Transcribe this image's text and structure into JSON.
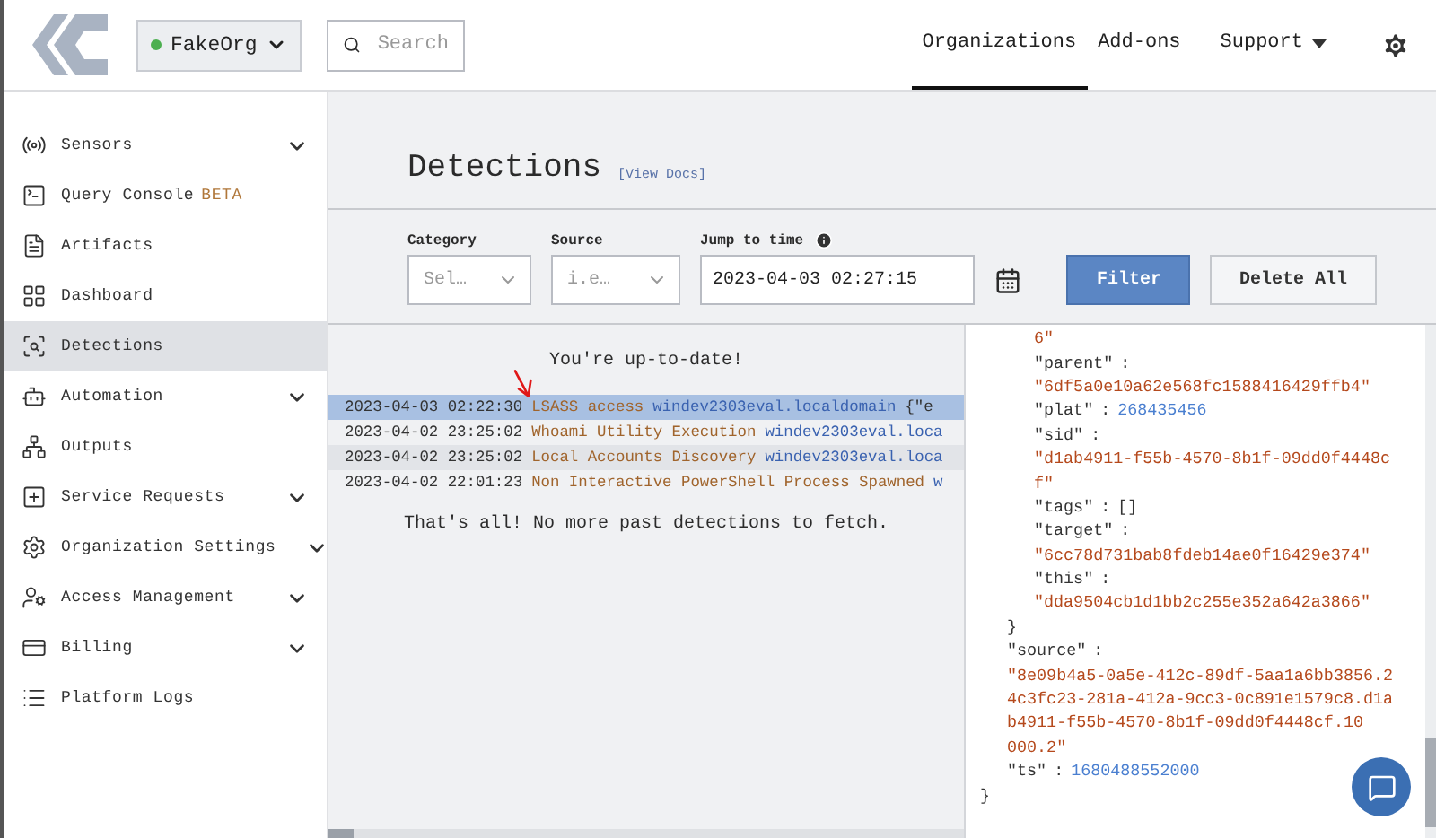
{
  "header": {
    "org": {
      "name": "FakeOrg"
    },
    "search": {
      "placeholder": "Search"
    },
    "nav": [
      {
        "label": "Organizations",
        "selected": true,
        "dropdown": false
      },
      {
        "label": "Add-ons",
        "selected": false,
        "dropdown": false
      },
      {
        "label": "Support",
        "selected": false,
        "dropdown": true
      }
    ]
  },
  "sidebar": {
    "items": [
      {
        "label": "Sensors",
        "expandable": true,
        "selected": false
      },
      {
        "label": "Query Console",
        "badge": "BETA",
        "expandable": false,
        "selected": false
      },
      {
        "label": "Artifacts",
        "expandable": false,
        "selected": false
      },
      {
        "label": "Dashboard",
        "expandable": false,
        "selected": false
      },
      {
        "label": "Detections",
        "expandable": false,
        "selected": true
      },
      {
        "label": "Automation",
        "expandable": true,
        "selected": false
      },
      {
        "label": "Outputs",
        "expandable": false,
        "selected": false
      },
      {
        "label": "Service Requests",
        "expandable": true,
        "selected": false
      },
      {
        "label": "Organization Settings",
        "expandable": true,
        "selected": false
      },
      {
        "label": "Access Management",
        "expandable": true,
        "selected": false
      },
      {
        "label": "Billing",
        "expandable": true,
        "selected": false
      },
      {
        "label": "Platform Logs",
        "expandable": false,
        "selected": false
      }
    ]
  },
  "page": {
    "title": "Detections",
    "docs_link": "[View Docs]"
  },
  "filters": {
    "category": {
      "label": "Category",
      "placeholder": "Sel…"
    },
    "source": {
      "label": "Source",
      "placeholder": "i.e…"
    },
    "jump_to_time": {
      "label": "Jump to time",
      "value": "2023-04-03 02:27:15"
    },
    "buttons": [
      {
        "label": "Filter",
        "kind": "primary"
      },
      {
        "label": "Delete All",
        "kind": "secondary"
      }
    ]
  },
  "log": {
    "status": "You're up-to-date!",
    "rows": [
      {
        "time": "2023-04-03 02:22:30",
        "name": "LSASS access",
        "host": "windev2303eval.localdomain",
        "extra": "{\"e",
        "selected": true
      },
      {
        "time": "2023-04-02 23:25:02",
        "name": "Whoami Utility Execution",
        "host": "windev2303eval.loca",
        "selected": false
      },
      {
        "time": "2023-04-02 23:25:02",
        "name": "Local Accounts Discovery",
        "host": "windev2303eval.loca",
        "selected": false
      },
      {
        "time": "2023-04-02 22:01:23",
        "name": "Non Interactive PowerShell Process Spawned",
        "host": "w",
        "selected": false
      }
    ],
    "footer": "That's all! No more past detections to fetch."
  },
  "json_view": {
    "children": [
      {
        "children": [
          {
            "children": [
              {
                "parts": [
                  {
                    "kind": "string",
                    "text": "6\""
                  }
                ]
              },
              {
                "parts": [
                  {
                    "kind": "key",
                    "text": "\"parent\""
                  },
                  {
                    "kind": "punct",
                    "text": ":"
                  }
                ]
              },
              {
                "parts": [
                  {
                    "kind": "string",
                    "text": "\"6df5a0e10a62e568fc1588416429ffb4\""
                  }
                ]
              },
              {
                "parts": [
                  {
                    "kind": "key",
                    "text": "\"plat\""
                  },
                  {
                    "kind": "punct",
                    "text": ":"
                  },
                  {
                    "kind": "number",
                    "text": "268435456"
                  }
                ]
              },
              {
                "parts": [
                  {
                    "kind": "key",
                    "text": "\"sid\""
                  },
                  {
                    "kind": "punct",
                    "text": ":"
                  }
                ]
              },
              {
                "parts": [
                  {
                    "kind": "string",
                    "text": "\"d1ab4911-f55b-4570-8b1f-09dd0f4448c"
                  }
                ]
              },
              {
                "parts": [
                  {
                    "kind": "string",
                    "text": "f\""
                  }
                ]
              },
              {
                "parts": [
                  {
                    "kind": "key",
                    "text": "\"tags\""
                  },
                  {
                    "kind": "punct",
                    "text": ":"
                  },
                  {
                    "kind": "punct",
                    "text": "[]"
                  }
                ]
              },
              {
                "parts": [
                  {
                    "kind": "key",
                    "text": "\"target\""
                  },
                  {
                    "kind": "punct",
                    "text": ":"
                  }
                ]
              },
              {
                "parts": [
                  {
                    "kind": "string",
                    "text": "\"6cc78d731bab8fdeb14ae0f16429e374\""
                  }
                ]
              },
              {
                "parts": [
                  {
                    "kind": "key",
                    "text": "\"this\""
                  },
                  {
                    "kind": "punct",
                    "text": ":"
                  }
                ]
              },
              {
                "parts": [
                  {
                    "kind": "string",
                    "text": "\"dda9504cb1d1bb2c255e352a642a3866\""
                  }
                ]
              }
            ]
          },
          {
            "parts": [
              {
                "kind": "punct",
                "text": "}"
              }
            ]
          },
          {
            "parts": [
              {
                "kind": "key",
                "text": "\"source\""
              },
              {
                "kind": "punct",
                "text": ":"
              }
            ]
          },
          {
            "parts": [
              {
                "kind": "string",
                "text": "\"8e09b4a5-0a5e-412c-89df-5aa1a6bb3856.2"
              }
            ]
          },
          {
            "parts": [
              {
                "kind": "string",
                "text": "4c3fc23-281a-412a-9cc3-0c891e1579c8.d1a"
              }
            ]
          },
          {
            "parts": [
              {
                "kind": "string",
                "text": "b4911-f55b-4570-8b1f-09dd0f4448cf.10"
              }
            ]
          },
          {
            "parts": [
              {
                "kind": "string",
                "text": "000.2\""
              }
            ]
          },
          {
            "parts": [
              {
                "kind": "key",
                "text": "\"ts\""
              },
              {
                "kind": "punct",
                "text": ":"
              },
              {
                "kind": "number",
                "text": "1680488552000"
              }
            ]
          }
        ]
      },
      {
        "parts": [
          {
            "kind": "punct",
            "text": "}"
          }
        ]
      }
    ]
  }
}
